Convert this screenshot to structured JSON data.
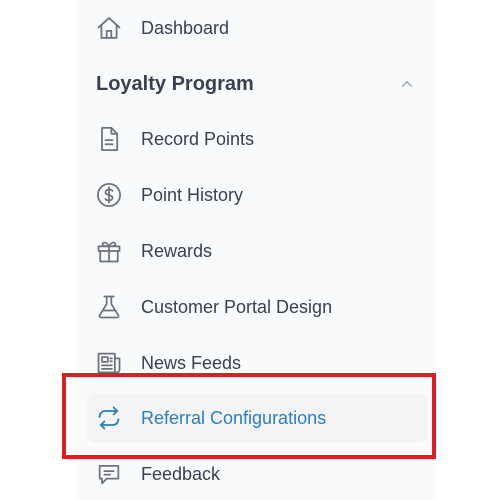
{
  "sidebar": {
    "items": {
      "dashboard": {
        "label": "Dashboard",
        "icon": "home-icon"
      },
      "record_points": {
        "label": "Record Points",
        "icon": "document-icon"
      },
      "point_history": {
        "label": "Point History",
        "icon": "dollar-circle-icon"
      },
      "rewards": {
        "label": "Rewards",
        "icon": "gift-icon"
      },
      "customer_portal_design": {
        "label": "Customer Portal Design",
        "icon": "flask-icon"
      },
      "news_feeds": {
        "label": "News Feeds",
        "icon": "newspaper-icon"
      },
      "referral_configurations": {
        "label": "Referral Configurations",
        "icon": "refresh-arrows-icon",
        "active": true
      },
      "feedback": {
        "label": "Feedback",
        "icon": "chat-bubble-icon"
      }
    },
    "section": {
      "title": "Loyalty Program",
      "state": "expanded"
    }
  },
  "colors": {
    "active": "#2b7fc1",
    "text": "#374151",
    "icon": "#6b7280",
    "highlight_border": "#e11d22",
    "sidebar_bg": "#f9fafb"
  }
}
